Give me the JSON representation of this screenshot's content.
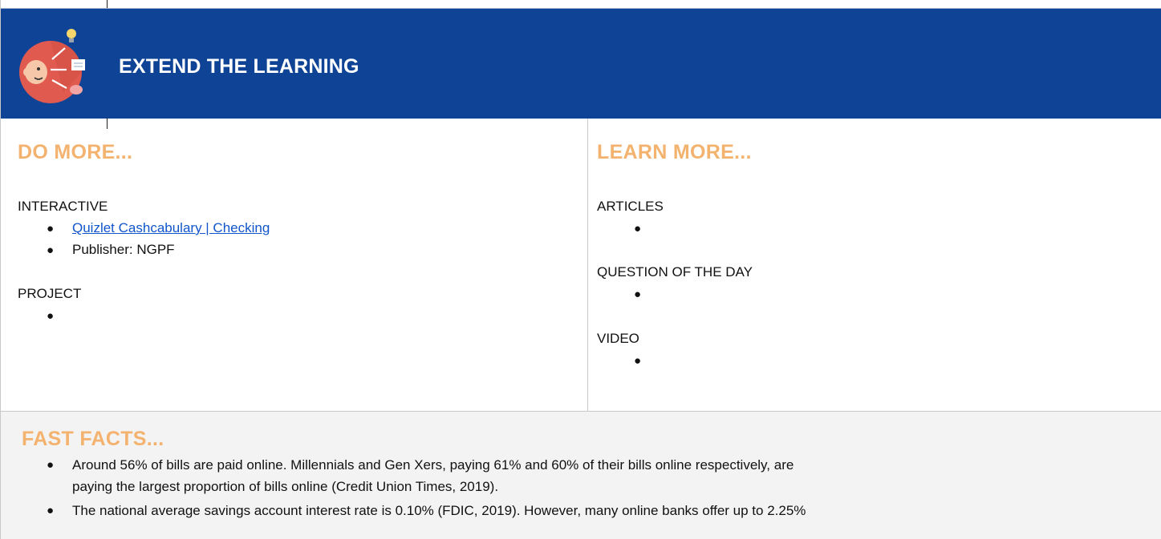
{
  "header": {
    "title": "EXTEND THE LEARNING",
    "icon": "learner-idea-icon",
    "colors": {
      "background": "#0e4396",
      "title": "#ffffff"
    }
  },
  "do_more": {
    "heading": "DO MORE...",
    "categories": [
      {
        "label": "INTERACTIVE",
        "items": [
          "Quizlet Cashcabulary | Checking",
          "Publisher:  NGPF"
        ]
      },
      {
        "label": "PROJECT",
        "items": [
          ""
        ]
      }
    ]
  },
  "learn_more": {
    "heading": "LEARN MORE...",
    "categories": [
      {
        "label": "ARTICLES",
        "items": [
          ""
        ]
      },
      {
        "label": "QUESTION OF THE DAY",
        "items": [
          ""
        ]
      },
      {
        "label": "VIDEO",
        "items": [
          ""
        ]
      }
    ]
  },
  "fast_facts": {
    "heading": "FAST FACTS...",
    "facts": [
      {
        "line1": "Around 56% of bills are paid online. Millennials and Gen Xers, paying 61% and 60% of their bills online respectively, are",
        "line2": "paying the largest proportion of bills online (Credit Union Times, 2019)."
      },
      {
        "line1": "The national average savings account interest rate is 0.10% (FDIC, 2019). However, many online banks offer up to 2.25%"
      }
    ]
  },
  "style": {
    "section_heading_color": "#f4b26f",
    "link_color": "#1155cc",
    "border_color": "#c9c9c9"
  }
}
